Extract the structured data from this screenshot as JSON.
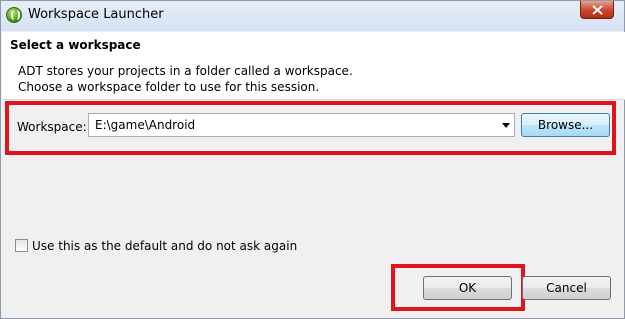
{
  "window": {
    "title": "Workspace Launcher"
  },
  "header": {
    "title": "Select a workspace",
    "description_line1": "ADT stores your projects in a folder called a workspace.",
    "description_line2": "Choose a workspace folder to use for this session."
  },
  "workspace": {
    "label": "Workspace:",
    "value": "E:\\game\\Android",
    "browse_label": "Browse..."
  },
  "default_option": {
    "label": "Use this as the default and do not ask again",
    "checked": false
  },
  "buttons": {
    "ok_label": "OK",
    "cancel_label": "Cancel"
  },
  "colors": {
    "highlight": "#e0141e",
    "titlebar": "#dbe6f4",
    "background": "#f0f0f0"
  },
  "icons": {
    "app": "adt-icon",
    "close": "close-icon",
    "dropdown": "chevron-down-icon"
  }
}
